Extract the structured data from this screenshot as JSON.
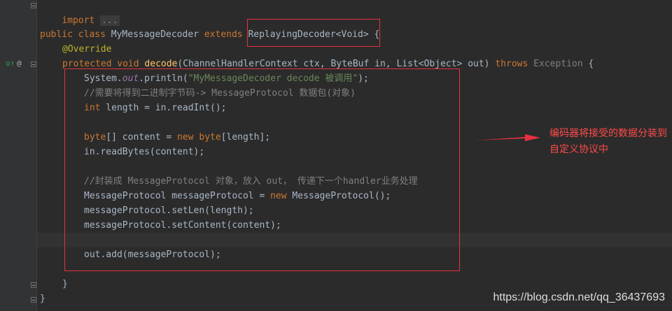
{
  "editor": {
    "lines": {
      "l1": {
        "kw": "import",
        "dots": "..."
      },
      "l3": {
        "kw1": "public",
        "kw2": "class",
        "name": "MyMessageDecoder",
        "kw3": "extends",
        "parent": "ReplayingDecoder<Void>",
        "brace": "{"
      },
      "l4": {
        "annotation": "@Override"
      },
      "l5": {
        "kw1": "protected",
        "kw2": "void",
        "method": "decode",
        "params_a": "(ChannelHandlerContext ctx, ByteBuf in, List<Object> out) ",
        "throws_kw": "throws",
        "exception": " Exception",
        "brace": " {"
      },
      "l6": {
        "a": "System.",
        "field": "out",
        "b": ".println(",
        "str": "\"MyMessageDecoder decode 被调用\"",
        "c": ");"
      },
      "l7": {
        "comment": "//需要将得到二进制字节码-> MessageProtocol 数据包(对象)"
      },
      "l8": {
        "kw": "int",
        "rest": " length = in.readInt();"
      },
      "l10": {
        "kw1": "byte",
        "a": "[] content = ",
        "kw2": "new",
        "b": " ",
        "kw3": "byte",
        "c": "[length];"
      },
      "l11": {
        "text": "in.readBytes(content);"
      },
      "l13": {
        "comment": "//封装成 MessageProtocol 对象，放入 out， 传递下一个handler业务处理"
      },
      "l14": {
        "a": "MessageProtocol messageProtocol = ",
        "kw": "new",
        "b": " MessageProtocol();"
      },
      "l15": {
        "text": "messageProtocol.setLen(length);"
      },
      "l16": {
        "text": "messageProtocol.setContent(content);"
      },
      "l18": {
        "text": "out.add(messageProtocol);"
      },
      "l20": {
        "text": "}"
      },
      "l21": {
        "text": "}"
      }
    }
  },
  "gutter": {
    "override_icon": "o↑",
    "at_icon": "@"
  },
  "annotation_note": "编码器将接受的数据分装到自定义协议中",
  "watermark": "https://blog.csdn.net/qq_36437693",
  "colors": {
    "background": "#2b2b2b",
    "keyword": "#cc7832",
    "annotation": "#bbb529",
    "string": "#6a8759",
    "comment": "#808080",
    "highlight_box": "#e5313f"
  }
}
